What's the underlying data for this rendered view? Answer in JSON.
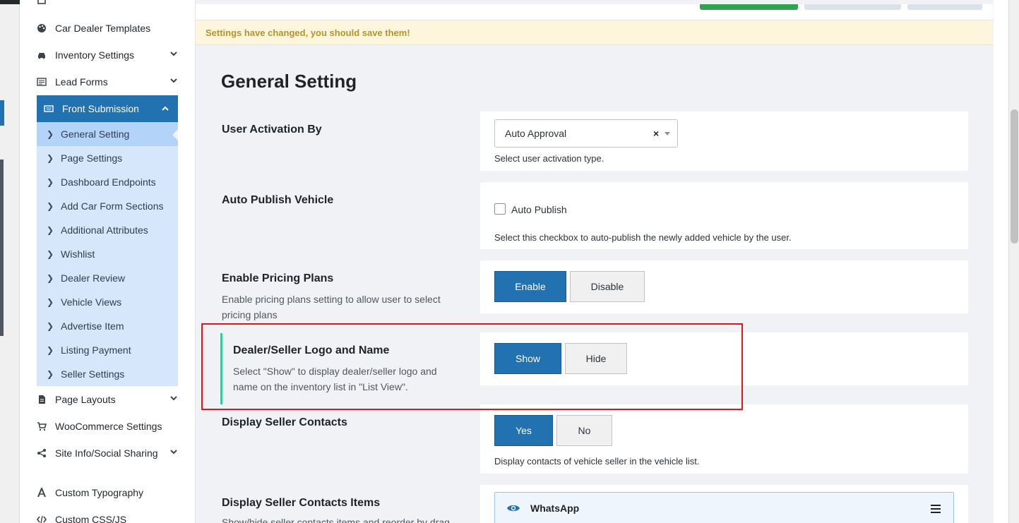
{
  "sidebar": {
    "items_above": [
      {
        "label": "Car Dealer Templates",
        "icon": "palette-icon",
        "has_chevron": false
      },
      {
        "label": "Inventory Settings",
        "icon": "car-icon",
        "has_chevron": true
      },
      {
        "label": "Lead Forms",
        "icon": "form-icon",
        "has_chevron": true
      }
    ],
    "active_parent": {
      "label": "Front Submission",
      "icon": "keyboard-icon"
    },
    "submenu": [
      {
        "label": "General Setting"
      },
      {
        "label": "Page Settings"
      },
      {
        "label": "Dashboard Endpoints"
      },
      {
        "label": "Add Car Form Sections"
      },
      {
        "label": "Additional Attributes"
      },
      {
        "label": "Wishlist"
      },
      {
        "label": "Dealer Review"
      },
      {
        "label": "Vehicle Views"
      },
      {
        "label": "Advertise Item"
      },
      {
        "label": "Listing Payment"
      },
      {
        "label": "Seller Settings"
      }
    ],
    "items_below": [
      {
        "label": "Page Layouts",
        "icon": "file-icon",
        "has_chevron": true
      },
      {
        "label": "WooCommerce Settings",
        "icon": "cart-icon",
        "has_chevron": false
      },
      {
        "label": "Site Info/Social Sharing",
        "icon": "share-icon",
        "has_chevron": true
      },
      {
        "label": "Custom Typography",
        "icon": "typography-icon",
        "has_chevron": false
      },
      {
        "label": "Custom CSS/JS",
        "icon": "code-icon",
        "has_chevron": false
      }
    ]
  },
  "notice": "Settings have changed, you should save them!",
  "page_title": "General Setting",
  "settings": {
    "user_activation": {
      "title": "User Activation By",
      "selected": "Auto Approval",
      "clear": "×",
      "help": "Select user activation type."
    },
    "auto_publish": {
      "title": "Auto Publish Vehicle",
      "checkbox_label": "Auto Publish",
      "checked": false,
      "help": "Select this checkbox to auto-publish the newly added vehicle by the user."
    },
    "pricing_plans": {
      "title": "Enable Pricing Plans",
      "description": "Enable pricing plans setting to allow user to select pricing plans",
      "options": [
        "Enable",
        "Disable"
      ],
      "selected": "Enable"
    },
    "dealer_logo": {
      "title": "Dealer/Seller Logo and Name",
      "description": "Select \"Show\" to display dealer/seller logo and name on the inventory list in \"List View\".",
      "options": [
        "Show",
        "Hide"
      ],
      "selected": "Show"
    },
    "seller_contacts": {
      "title": "Display Seller Contacts",
      "options": [
        "Yes",
        "No"
      ],
      "selected": "Yes",
      "help": "Display contacts of vehicle seller in the vehicle list."
    },
    "seller_contact_items": {
      "title": "Display Seller Contacts Items",
      "description": "Show/hide seller contacts items and reorder by drag",
      "items": [
        {
          "label": "WhatsApp",
          "visible": true
        }
      ]
    }
  },
  "colors": {
    "accent": "#2271b1",
    "submenu_bg": "#d6e6fb",
    "highlight_border": "#e3141b",
    "active_indicator": "#3ec6a0"
  }
}
